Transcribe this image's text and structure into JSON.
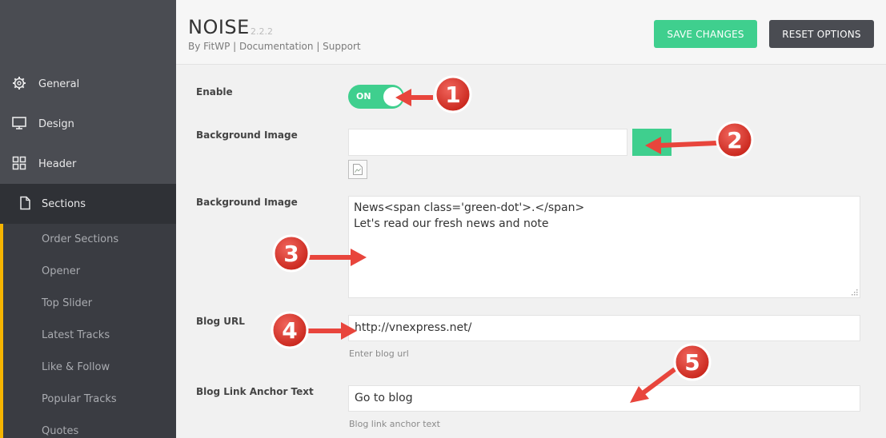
{
  "header": {
    "title": "NOISE",
    "version": "2.2.2",
    "byline": "By FitWP | Documentation | Support",
    "save_label": "SAVE CHANGES",
    "reset_label": "RESET OPTIONS"
  },
  "sidebar": {
    "items": [
      {
        "label": "General",
        "icon": "gear-icon"
      },
      {
        "label": "Design",
        "icon": "monitor-icon"
      },
      {
        "label": "Header",
        "icon": "grid-icon"
      },
      {
        "label": "Sections",
        "icon": "document-icon"
      }
    ],
    "subitems": [
      "Order Sections",
      "Opener",
      "Top Slider",
      "Latest Tracks",
      "Like & Follow",
      "Popular Tracks",
      "Quotes"
    ]
  },
  "form": {
    "enable_label": "Enable",
    "toggle_text": "ON",
    "bg_image_label": "Background Image",
    "bg_image_value": "",
    "bg_text_label": "Background Image",
    "bg_text_line1": "News<span class='green-dot'>.</span>",
    "bg_text_line2": "Let's read our fresh news and note",
    "blog_url_label": "Blog URL",
    "blog_url_value": "http://vnexpress.net/",
    "blog_url_hint": "Enter blog url",
    "anchor_label": "Blog Link Anchor Text",
    "anchor_value": "Go to blog",
    "anchor_hint": "Blog link anchor text"
  },
  "annotations": [
    "1",
    "2",
    "3",
    "4",
    "5"
  ],
  "colors": {
    "accent": "#3fcf8e",
    "sidebar_bg": "#3a3c42",
    "active_bar": "#f6b500",
    "arrow": "#e8453c"
  }
}
